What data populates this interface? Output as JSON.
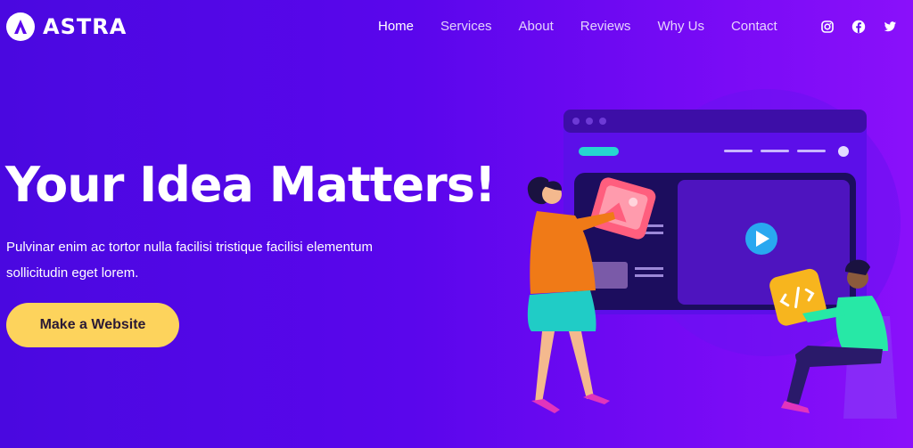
{
  "brand": {
    "name": "ASTRA"
  },
  "nav": {
    "items": [
      {
        "label": "Home",
        "active": true
      },
      {
        "label": "Services",
        "active": false
      },
      {
        "label": "About",
        "active": false
      },
      {
        "label": "Reviews",
        "active": false
      },
      {
        "label": "Why Us",
        "active": false
      },
      {
        "label": "Contact",
        "active": false
      }
    ]
  },
  "social": {
    "icons": [
      "instagram-icon",
      "facebook-icon",
      "twitter-icon"
    ]
  },
  "hero": {
    "title": "Your Idea Matters!",
    "description": "Pulvinar enim ac tortor nulla facilisi tristique facilisi elementum sollicitudin eget lorem.",
    "cta_label": "Make a Website"
  },
  "colors": {
    "background_start": "#4a08e0",
    "background_end": "#8a10fa",
    "cta": "#fdd35c",
    "cta_text": "#2a1a35"
  }
}
